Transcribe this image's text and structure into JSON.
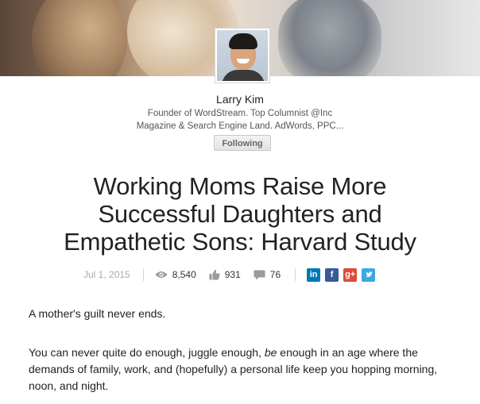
{
  "author": {
    "name": "Larry Kim",
    "title_line1": "Founder of WordStream. Top Columnist @Inc",
    "title_line2": "Magazine & Search Engine Land. AdWords, PPC...",
    "follow_label": "Following"
  },
  "article": {
    "title_line1": "Working Moms Raise More",
    "title_line2": "Successful Daughters and",
    "title_line3": "Empathetic Sons: Harvard Study",
    "date": "Jul 1, 2015",
    "views": "8,540",
    "likes": "931",
    "comments": "76"
  },
  "share": {
    "linkedin": "in",
    "facebook": "f",
    "googleplus": "g+",
    "twitter": "t",
    "colors": {
      "linkedin": "#0077b5",
      "facebook": "#3b5998",
      "googleplus": "#dd4b39",
      "twitter": "#3ba9e1"
    }
  },
  "body": {
    "p1": "A mother's guilt never ends.",
    "p2_part1": "You can never quite do enough, juggle enough, ",
    "p2_emph": "be",
    "p2_part2": " enough in an age where the demands of family, work, and (hopefully) a personal life keep you hopping morning, noon, and night."
  },
  "icons": {
    "views": "eye-icon",
    "likes": "thumbs-up-icon",
    "comments": "comment-icon"
  }
}
